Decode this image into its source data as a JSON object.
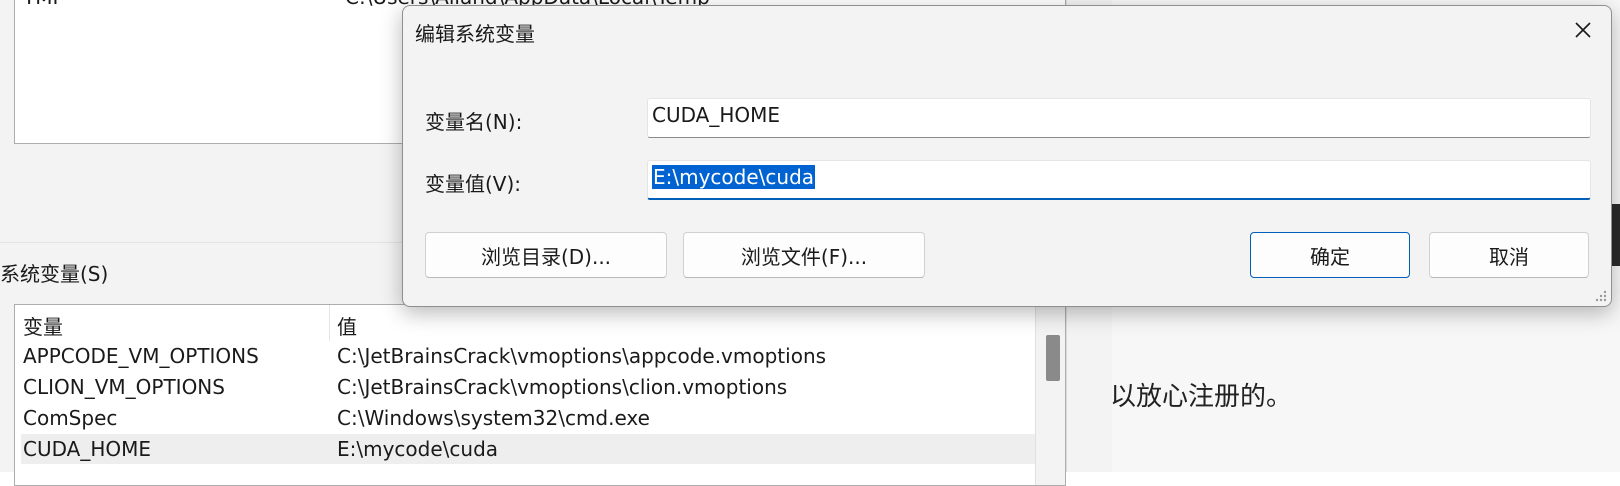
{
  "background": {
    "top_list": {
      "name": "TMP",
      "value": "C:\\Users\\Alland\\AppData\\Local\\Temp"
    },
    "system_vars_label": "系统变量(S)",
    "table": {
      "headers": [
        "变量",
        "值"
      ],
      "rows": [
        {
          "name": "APPCODE_VM_OPTIONS",
          "value": "C:\\JetBrainsCrack\\vmoptions\\appcode.vmoptions"
        },
        {
          "name": "CLION_VM_OPTIONS",
          "value": "C:\\JetBrainsCrack\\vmoptions\\clion.vmoptions"
        },
        {
          "name": "ComSpec",
          "value": "C:\\Windows\\system32\\cmd.exe"
        },
        {
          "name": "CUDA_HOME",
          "value": "E:\\mycode\\cuda"
        }
      ]
    },
    "page_text": "以放心注册的。"
  },
  "dialog": {
    "title": "编辑系统变量",
    "close_icon": "close-icon",
    "name_label": "变量名(N):",
    "value_label": "变量值(V):",
    "name_value": "CUDA_HOME",
    "value_value": "E:\\mycode\\cuda",
    "buttons": {
      "browse_dir": "浏览目录(D)...",
      "browse_file": "浏览文件(F)...",
      "ok": "确定",
      "cancel": "取消"
    }
  },
  "colors": {
    "accent": "#005fb8",
    "selection": "#0063d1"
  }
}
